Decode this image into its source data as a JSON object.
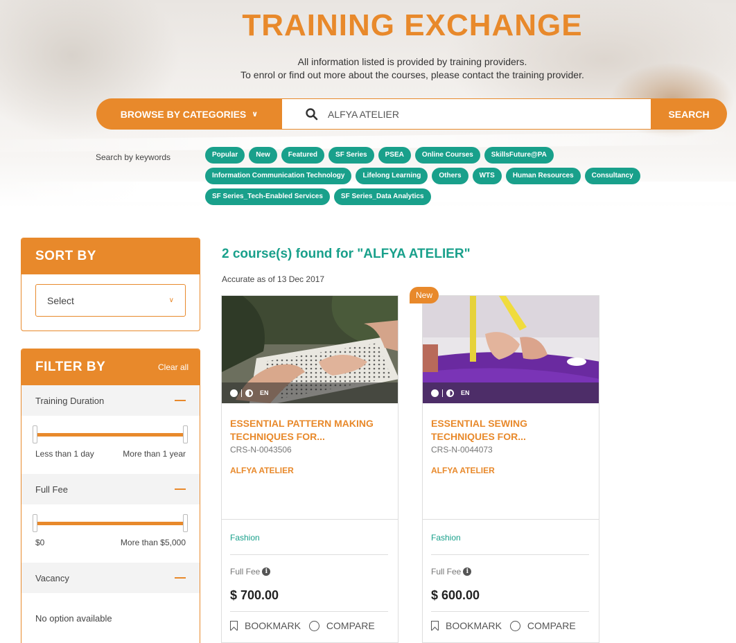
{
  "header": {
    "title": "TRAINING EXCHANGE",
    "subtitle_line1": "All information listed is provided by training providers.",
    "subtitle_line2": "To enrol or find out more about the courses, please contact the training provider."
  },
  "search": {
    "browse_label": "BROWSE BY CATEGORIES",
    "query": "ALFYA ATELIER",
    "button_label": "SEARCH"
  },
  "keywords": {
    "label": "Search by keywords",
    "tags": [
      "Popular",
      "New",
      "Featured",
      "SF Series",
      "PSEA",
      "Online Courses",
      "SkillsFuture@PA",
      "Information Communication Technology",
      "Lifelong Learning",
      "Others",
      "WTS",
      "Human Resources",
      "Consultancy",
      "SF Series_Tech-Enabled Services",
      "SF Series_Data Analytics"
    ]
  },
  "sort": {
    "heading": "SORT BY",
    "select_value": "Select"
  },
  "filter": {
    "heading": "FILTER BY",
    "clear_label": "Clear all",
    "training_duration": {
      "label": "Training Duration",
      "min_label": "Less than 1 day",
      "max_label": "More than 1 year"
    },
    "full_fee": {
      "label": "Full Fee",
      "min_label": "$0",
      "max_label": "More than $5,000"
    },
    "vacancy": {
      "label": "Vacancy",
      "empty_text": "No option available"
    }
  },
  "results": {
    "title": "2 course(s) found for \"ALFYA ATELIER\"",
    "accurate_as_of": "Accurate as of 13 Dec 2017",
    "new_badge": "New",
    "fee_label": "Full Fee",
    "bookmark_label": "BOOKMARK",
    "compare_label": "COMPARE",
    "language": "EN",
    "courses": [
      {
        "title_line1": "ESSENTIAL PATTERN MAKING",
        "title_line2": "TECHNIQUES FOR...",
        "code": "CRS-N-0043506",
        "provider": "ALFYA ATELIER",
        "category": "Fashion",
        "fee": "$ 700.00"
      },
      {
        "title_line1": "ESSENTIAL SEWING",
        "title_line2": "TECHNIQUES FOR...",
        "code": "CRS-N-0044073",
        "provider": "ALFYA ATELIER",
        "category": "Fashion",
        "fee": "$ 600.00"
      }
    ]
  },
  "colors": {
    "accent": "#e8892b",
    "teal": "#19a08b"
  }
}
